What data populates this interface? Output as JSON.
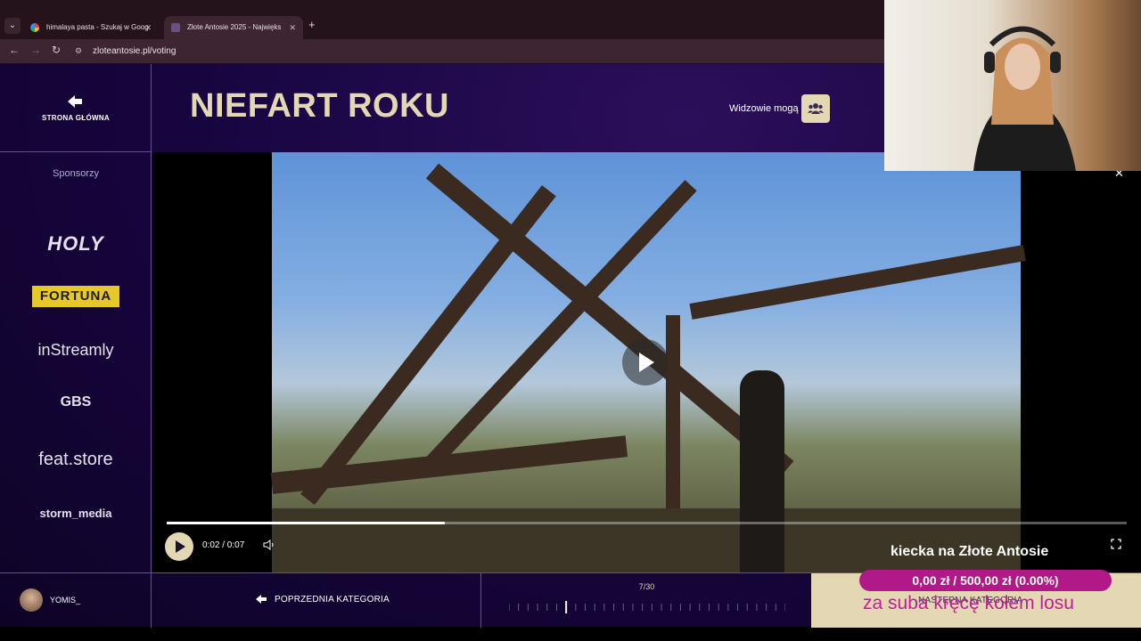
{
  "browser": {
    "tabs": [
      {
        "title": "himalaya pasta - Szukaj w Goog",
        "active": false
      },
      {
        "title": "Złote Antosie 2025 - Najwięks",
        "active": true
      }
    ],
    "url": "zloteantosie.pl/voting"
  },
  "header": {
    "home_label": "STRONA GŁÓWNA",
    "category_title": "NIEFART ROKU",
    "viewers_label": "Widzowie mogą"
  },
  "sidebar": {
    "title": "Sponsorzy",
    "sponsors": [
      "HOLY",
      "FORTUNA",
      "inStreamly",
      "GBS",
      "feat.store",
      "storm_media"
    ]
  },
  "player": {
    "time": "0:02 / 0:07",
    "progress": 0.29
  },
  "footer": {
    "username": "YOMIS_",
    "prev_label": "POPRZEDNIA KATEGORIA",
    "counter": "7/30",
    "current": 7,
    "total": 30,
    "next_label": "NASTĘPNA KATEGORIA"
  },
  "stream_overlay": {
    "caption": "kiecka na Złote Antosie",
    "goal": "0,00 zł / 500,00 zł (0.00%)",
    "goal_percent": 0,
    "message": "za suba kręcę kołem losu"
  },
  "colors": {
    "gold": "#e4d8b4",
    "background": "#16063a",
    "goal_pink": "#b01987"
  }
}
